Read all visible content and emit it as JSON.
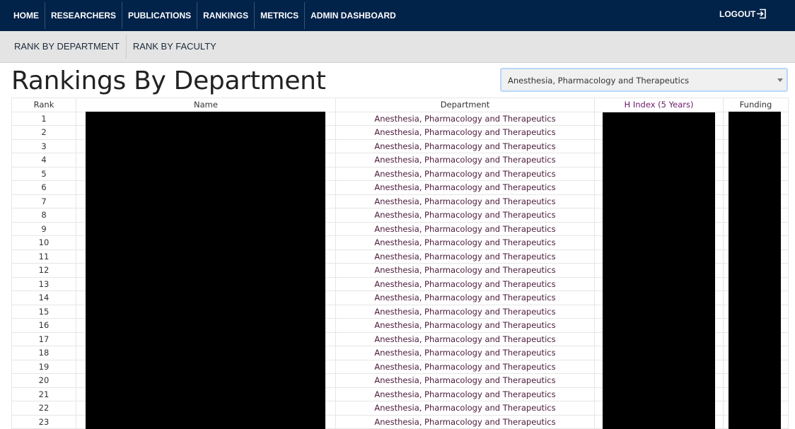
{
  "nav": {
    "items": [
      "HOME",
      "RESEARCHERS",
      "PUBLICATIONS",
      "RANKINGS",
      "METRICS",
      "ADMIN DASHBOARD"
    ],
    "logout": "LOGOUT"
  },
  "subnav": {
    "items": [
      "RANK BY DEPARTMENT",
      "RANK BY FACULTY"
    ]
  },
  "page_title": "Rankings By Department",
  "department_select": {
    "value": "Anesthesia, Pharmacology and Therapeutics"
  },
  "table": {
    "headers": [
      "Rank",
      "Name",
      "Department",
      "H Index (5 Years)",
      "Funding"
    ],
    "rows": [
      1,
      2,
      3,
      4,
      5,
      6,
      7,
      8,
      9,
      10,
      11,
      12,
      13,
      14,
      15,
      16,
      17,
      18,
      19,
      20,
      21,
      22,
      23
    ],
    "department": "Anesthesia, Pharmacology and Therapeutics"
  }
}
